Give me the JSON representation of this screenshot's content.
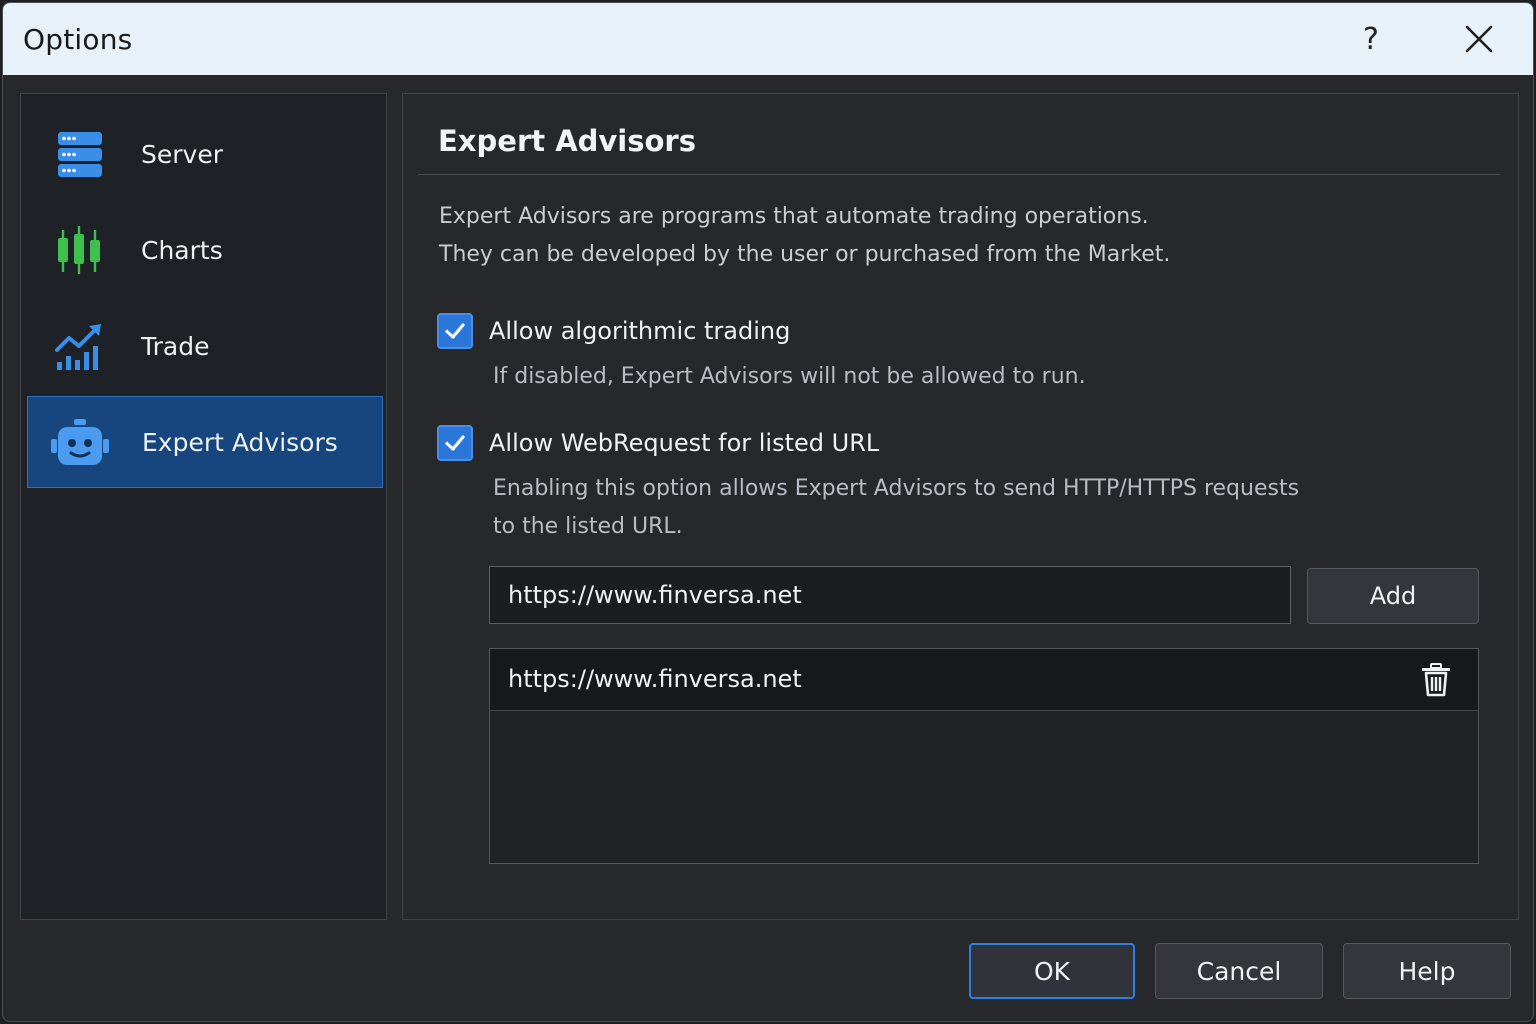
{
  "window": {
    "title": "Options",
    "help_glyph": "?"
  },
  "sidebar": {
    "items": [
      {
        "label": "Server",
        "icon": "server-icon",
        "active": false
      },
      {
        "label": "Charts",
        "icon": "candlestick-chart-icon",
        "active": false
      },
      {
        "label": "Trade",
        "icon": "trade-growth-icon",
        "active": false
      },
      {
        "label": "Expert Advisors",
        "icon": "robot-icon",
        "active": true
      }
    ]
  },
  "main": {
    "title": "Expert Advisors",
    "description": [
      "Expert Advisors are programs that automate trading operations.",
      "They can be developed by the user or purchased from the Market."
    ],
    "options": [
      {
        "label": "Allow algorithmic trading",
        "checked": true,
        "description": [
          "If disabled, Expert Advisors will not be allowed to run."
        ]
      },
      {
        "label": "Allow WebRequest for listed URL",
        "checked": true,
        "description": [
          "Enabling this option allows Expert Advisors to send HTTP/HTTPS requests",
          "to the listed URL."
        ]
      }
    ],
    "url_input": {
      "value": "https://www.finversa.net"
    },
    "add_button": "Add",
    "url_list": [
      "https://www.finversa.net"
    ]
  },
  "footer": {
    "ok": "OK",
    "cancel": "Cancel",
    "help": "Help"
  },
  "colors": {
    "accent": "#2a77d9",
    "active_nav": "#17467f",
    "candle_green": "#3fbf4f"
  }
}
